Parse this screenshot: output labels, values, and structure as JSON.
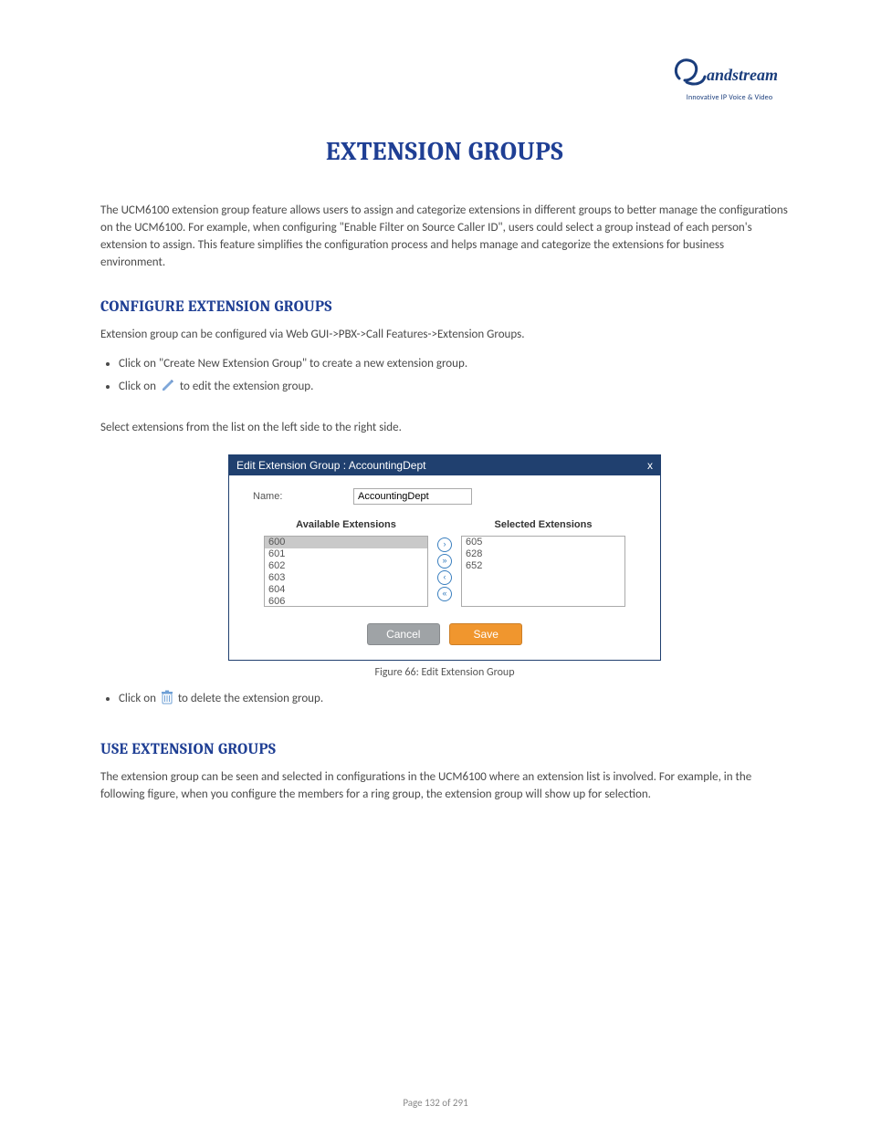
{
  "brand": {
    "name": "Grandstream",
    "tagline": "Innovative IP Voice & Video"
  },
  "title": "EXTENSION GROUPS",
  "intro_paragraphs": [
    "The UCM6100 extension group feature allows users to assign and categorize extensions in different groups to better manage the configurations on the UCM6100. For example, when configuring \"Enable Filter on Source Caller ID\", users could select a group instead of each person's extension to assign. This feature simplifies the configuration process and helps manage and categorize the extensions for business environment."
  ],
  "section_configure": {
    "heading": "CONFIGURE EXTENSION GROUPS",
    "lead": "Extension group can be configured via Web GUI->PBX->Call Features->Extension Groups.",
    "bullets": [
      "Click on \"Create New Extension Group\" to create a new extension group.",
      "Click on  to edit the extension group."
    ],
    "after_bullets": "Select extensions from the list on the left side to the right side.",
    "figure_caption": "Figure 66: Edit Extension Group",
    "delete_bullet": "Click on  to delete the extension group."
  },
  "dialog": {
    "title": "Edit Extension Group : AccountingDept",
    "name_label": "Name:",
    "name_value": "AccountingDept",
    "available_head": "Available Extensions",
    "selected_head": "Selected Extensions",
    "available": [
      "600",
      "601",
      "602",
      "603",
      "604",
      "606"
    ],
    "selected": [
      "605",
      "628",
      "652"
    ],
    "selected_highlight_index": 0,
    "buttons": {
      "cancel": "Cancel",
      "save": "Save"
    },
    "move_labels": {
      "add_one": "›",
      "add_all": "»",
      "remove_one": "‹",
      "remove_all": "«"
    }
  },
  "section_use": {
    "heading": "USE EXTENSION GROUPS",
    "paragraph": "The extension group can be seen and selected in configurations in the UCM6100 where an extension list is involved. For example, in the following figure, when you configure the members for a ring group, the extension group will show up for selection."
  },
  "page_number": "Page 132 of 291"
}
